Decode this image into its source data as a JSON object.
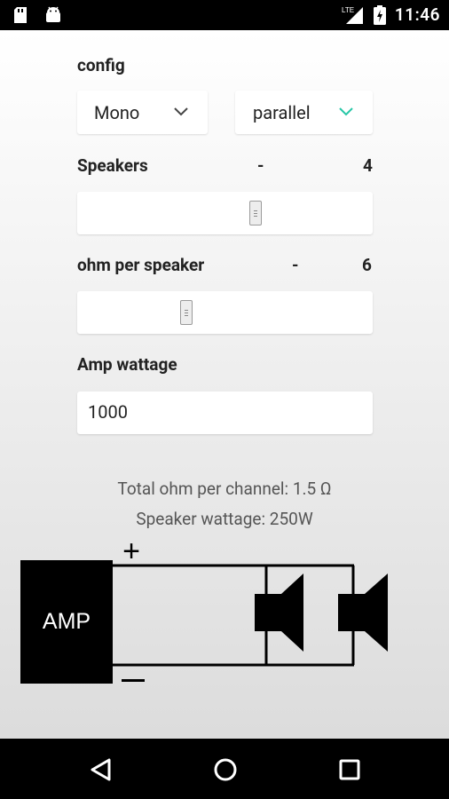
{
  "status_bar": {
    "time": "11:46",
    "network": "LTE",
    "icons": [
      "sd-card-icon",
      "android-icon",
      "signal-icon",
      "battery-charging-icon"
    ]
  },
  "config": {
    "label": "config",
    "mode_value": "Mono",
    "wiring_value": "parallel"
  },
  "speakers": {
    "label": "Speakers",
    "separator": "-",
    "value": "4",
    "slider_fraction": 0.62
  },
  "ohm": {
    "label": "ohm per speaker",
    "separator": "-",
    "value": "6",
    "slider_fraction": 0.35
  },
  "amp": {
    "label": "Amp wattage",
    "value": "1000"
  },
  "results": {
    "total_ohm": "Total ohm per channel: 1.5 Ω",
    "speaker_wattage": "Speaker wattage: 250W"
  },
  "diagram": {
    "amp_label": "AMP",
    "plus_label": "+",
    "minus_label": "−"
  },
  "colors": {
    "accent": "#26c6a6",
    "background_top": "#ffffff",
    "background_bottom": "#dcdcdc"
  }
}
